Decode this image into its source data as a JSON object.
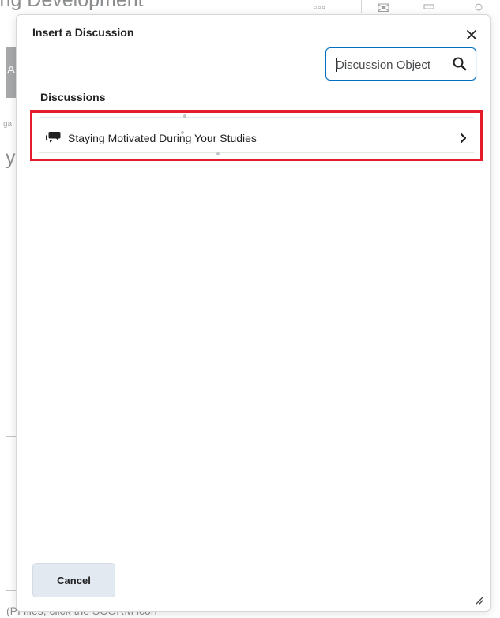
{
  "background": {
    "title_fragment": "ing Development",
    "sidebar_fragment": "A",
    "text_fragment_1": "ga",
    "text_fragment_2": "y",
    "footer_fragment": "(PI files, click the SCORM icon"
  },
  "dialog": {
    "title": "Insert a Discussion",
    "search": {
      "placeholder": "Discussion Object",
      "value": ""
    },
    "section_heading": "Discussions",
    "items": [
      {
        "label": "Staying Motivated During Your Studies"
      }
    ],
    "cancel_label": "Cancel"
  },
  "colors": {
    "highlight": "#e41b2b",
    "focus_border": "#006fbf",
    "button_bg": "#e3e9f1"
  },
  "icons": {
    "close": "close-icon",
    "search": "search-icon",
    "discussion": "discussion-icon",
    "chevron": "chevron-right-icon",
    "resize": "resize-handle-icon"
  }
}
